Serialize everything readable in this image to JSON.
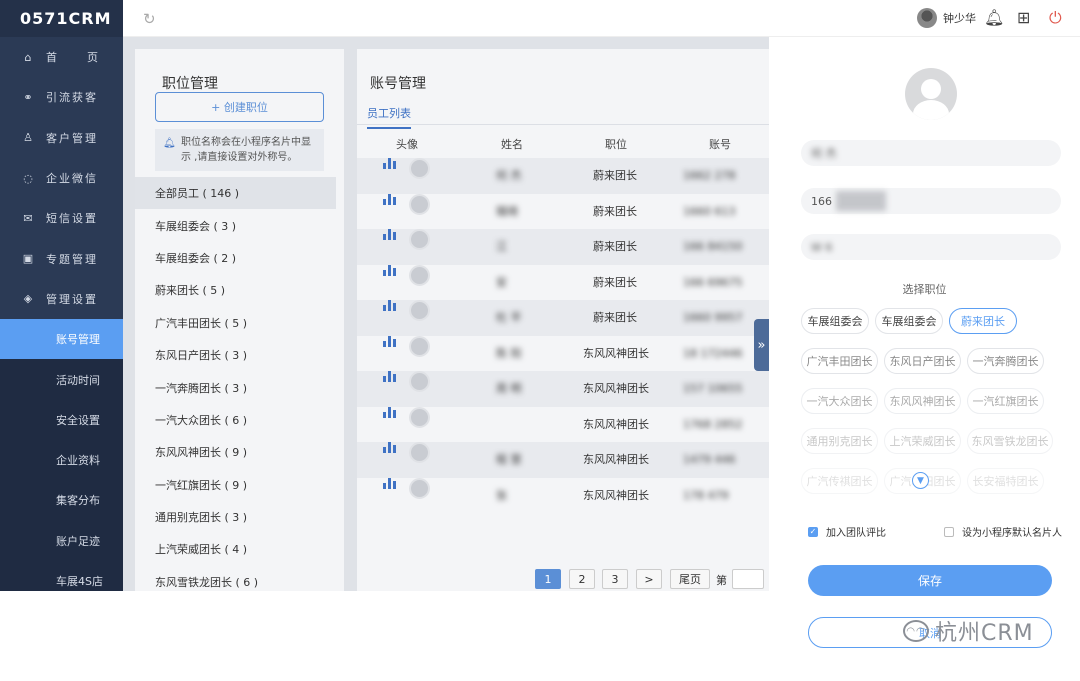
{
  "app": {
    "logo": "0571CRM"
  },
  "sidebar": {
    "items": [
      {
        "label_a": "首",
        "label_b": "页",
        "icon": "home-icon"
      },
      {
        "label": "引流获客",
        "icon": "share-icon"
      },
      {
        "label": "客户管理",
        "icon": "user-icon"
      },
      {
        "label": "企业微信",
        "icon": "chat-icon"
      },
      {
        "label": "短信设置",
        "icon": "mail-icon"
      },
      {
        "label": "专题管理",
        "icon": "topic-icon"
      },
      {
        "label": "管理设置",
        "icon": "layers-icon"
      }
    ],
    "subitems": [
      {
        "label": "账号管理"
      },
      {
        "label": "活动时间"
      },
      {
        "label": "安全设置"
      },
      {
        "label": "企业资料"
      },
      {
        "label": "集客分布"
      },
      {
        "label": "账户足迹"
      },
      {
        "label": "车展4S店"
      }
    ]
  },
  "topbar": {
    "username": "钟少华"
  },
  "positions": {
    "title": "职位管理",
    "create_label": "+ 创建职位",
    "tip": "职位名称会在小程序名片中显示 ,请直接设置对外称号。",
    "items": [
      "全部员工 ( 146 )",
      "车展组委会 ( 3 )",
      "车展组委会 ( 2 )",
      "蔚来团长 ( 5 )",
      "广汽丰田团长 ( 5 )",
      "东风日产团长 ( 3 )",
      "一汽奔腾团长 ( 3 )",
      "一汽大众团长 ( 6 )",
      "东风风神团长 ( 9 )",
      "一汽红旗团长 ( 9 )",
      "通用别克团长 ( 3 )",
      "上汽荣威团长 ( 4 )",
      "东风雪铁龙团长 ( 6 )"
    ]
  },
  "accounts": {
    "title": "账号管理",
    "tab": "员工列表",
    "columns": {
      "avatar": "头像",
      "name": "姓名",
      "position": "职位",
      "account": "账号"
    },
    "rows": [
      {
        "name": "何 杰",
        "position": "蔚来团长",
        "account": "1662 278"
      },
      {
        "name": "璐琦",
        "position": "蔚来团长",
        "account": "1660 613"
      },
      {
        "name": "江",
        "position": "蔚来团长",
        "account": "166 84150"
      },
      {
        "name": "安",
        "position": "蔚来团长",
        "account": "166 69675"
      },
      {
        "name": "杜 平",
        "position": "蔚来团长",
        "account": "1660 9957"
      },
      {
        "name": "陈 阳",
        "position": "东风风神团长",
        "account": "18 172446"
      },
      {
        "name": "周 明",
        "position": "东风风神团长",
        "account": "157 10655"
      },
      {
        "name": "",
        "position": "东风风神团长",
        "account": "1768 2852"
      },
      {
        "name": "程 慧",
        "position": "东风风神团长",
        "account": "1479 446"
      },
      {
        "name": "张",
        "position": "东风风神团长",
        "account": "178 479"
      }
    ],
    "pager": {
      "pages": [
        "1",
        "2",
        "3"
      ],
      "next": ">",
      "last": "尾页",
      "goto": "第"
    }
  },
  "drawer": {
    "name_value": "何 杰",
    "phone_value": "166",
    "wechat_value": "W 6",
    "section_title": "选择职位",
    "tags": [
      "车展组委会",
      "车展组委会",
      "蔚来团长",
      "广汽丰田团长",
      "东风日产团长",
      "一汽奔腾团长",
      "一汽大众团长",
      "东风风神团长",
      "一汽红旗团长",
      "通用别克团长",
      "上汽荣威团长",
      "东风雪铁龙团长",
      "广汽传祺团长",
      "广汽本田团长",
      "长安福特团长"
    ],
    "checkbox_rank": "加入团队评比",
    "checkbox_default": "设为小程序默认名片人",
    "save_label": "保存",
    "cancel_label": "取消"
  },
  "watermark": {
    "text": "杭州CRM"
  },
  "colors": {
    "accent": "#5b9ef2",
    "sidebar": "#2b3a55",
    "primary": "#3f72c4"
  }
}
